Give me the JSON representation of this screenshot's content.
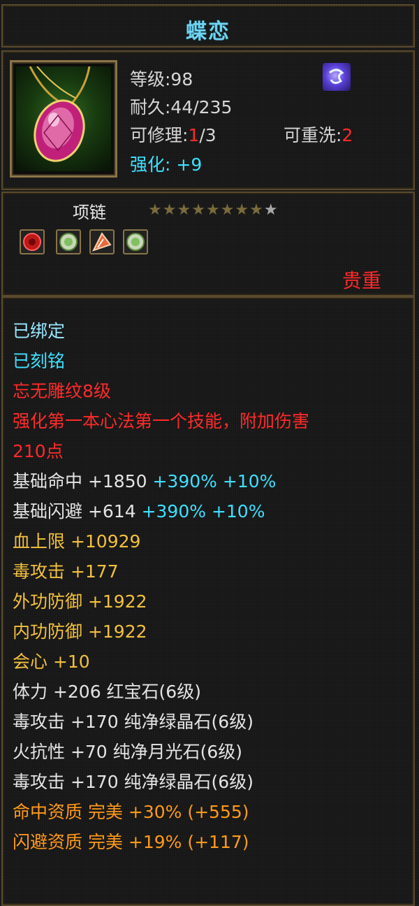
{
  "item": {
    "name": "蝶恋",
    "level_label": "等级:98",
    "durability_label": "耐久:44/235",
    "repair_prefix": "可修理:",
    "repair_current": "1",
    "repair_sep": "/3",
    "rewash_prefix": "可重洗:",
    "rewash_value": "2",
    "enhance_label": "强化: +9",
    "type_label": "项链",
    "stars": {
      "filled": 8,
      "total": 9
    },
    "rarity": "贵重"
  },
  "colors": {
    "title": "#6fd3f0",
    "red": "#ff2a2a",
    "cyan": "#3ee0ff",
    "yellow": "#f2c03c",
    "orange": "#ff9a18",
    "border": "#8a7448"
  },
  "gems": [
    {
      "icon": "red-gem-icon"
    },
    {
      "icon": "green-crystal-icon"
    },
    {
      "icon": "moonstone-icon"
    },
    {
      "icon": "green-crystal-icon"
    }
  ],
  "attributes": {
    "bound": "已绑定",
    "engraved": "已刻铭",
    "carving": "忘无雕纹8级",
    "skill_line1": "强化第一本心法第一个技能，附加伤害",
    "skill_line2": "210点",
    "hit": {
      "label": "基础命中 +1850",
      "bonus1": "+390%",
      "bonus2": "+10%"
    },
    "dodge": {
      "label": "基础闪避 +614",
      "bonus1": "+390%",
      "bonus2": "+10%"
    },
    "hp": "血上限 +10929",
    "poison1": "毒攻击 +177",
    "ext_def": "外功防御 +1922",
    "int_def": "内功防御 +1922",
    "crit": "会心 +10",
    "gem1": "体力 +206 红宝石(6级)",
    "gem2": "毒攻击 +170 纯净绿晶石(6级)",
    "gem3": "火抗性 +70 纯净月光石(6级)",
    "gem4": "毒攻击 +170 纯净绿晶石(6级)",
    "aptitude_hit": "命中资质  完美 +30% (+555)",
    "aptitude_dodge": "闪避资质  完美 +19% (+117)"
  }
}
